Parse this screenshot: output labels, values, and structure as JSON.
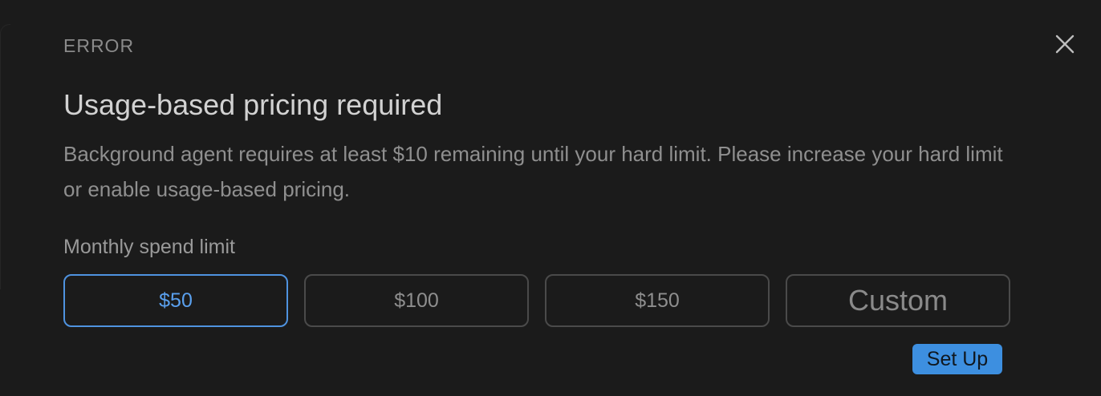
{
  "dialog": {
    "eyebrow": "ERROR",
    "title": "Usage-based pricing required",
    "description": "Background agent requires at least $10 remaining until your hard limit. Please increase your hard limit or enable usage-based pricing.",
    "close_icon": "close-icon"
  },
  "spend_limit": {
    "label": "Monthly spend limit",
    "options": [
      "$50",
      "$100",
      "$150",
      "Custom"
    ],
    "selected": "$50"
  },
  "actions": {
    "setup_label": "Set Up"
  },
  "colors": {
    "background": "#1c1c1c",
    "accent": "#4f93e0",
    "setup_button": "#3d8fe0"
  }
}
